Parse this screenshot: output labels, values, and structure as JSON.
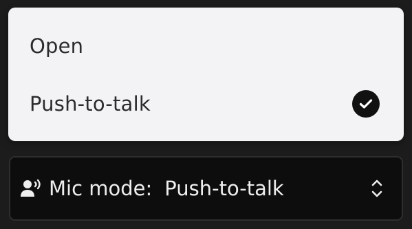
{
  "menu": {
    "options": [
      {
        "label": "Open",
        "selected": false
      },
      {
        "label": "Push-to-talk",
        "selected": true
      }
    ],
    "selected_icon": "checkmark-circle-icon"
  },
  "select": {
    "icon": "speaking-person-icon",
    "prefix": "Mic mode:",
    "value": "Push-to-talk",
    "caret_icon": "chevron-up-down-icon"
  },
  "colors": {
    "background": "#1c1c1c",
    "menu_background": "#f3f3f5",
    "select_background": "#0d0d0d",
    "check_fill": "#111111"
  }
}
